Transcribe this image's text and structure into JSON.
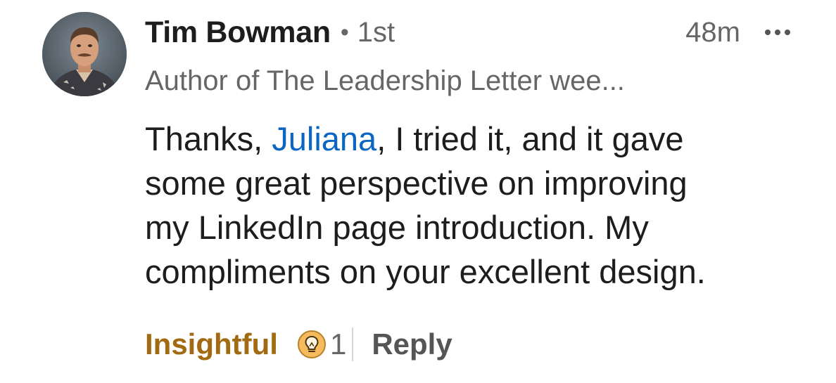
{
  "comment": {
    "author": {
      "name": "Tim Bowman",
      "connection_separator": "•",
      "connection_degree": "1st",
      "headline": "Author of The Leadership Letter wee..."
    },
    "timestamp": "48m",
    "more_icon": "ellipsis-icon",
    "body": {
      "line1_before": "Thanks, ",
      "mention": "Juliana",
      "line1_after": ", I tried it, and it gave",
      "line2": "some great perspective on improving",
      "line3": "my LinkedIn page introduction.  My",
      "line4": "compliments on your excellent design."
    },
    "actions": {
      "reaction_label": "Insightful",
      "reaction_icon": "lightbulb-icon",
      "reaction_count": "1",
      "reply_label": "Reply"
    }
  },
  "colors": {
    "mention": "#0a66c2",
    "insightful": "#a26a12",
    "insightful_icon_bg": "#f5bb5c",
    "secondary_text": "#666666"
  }
}
